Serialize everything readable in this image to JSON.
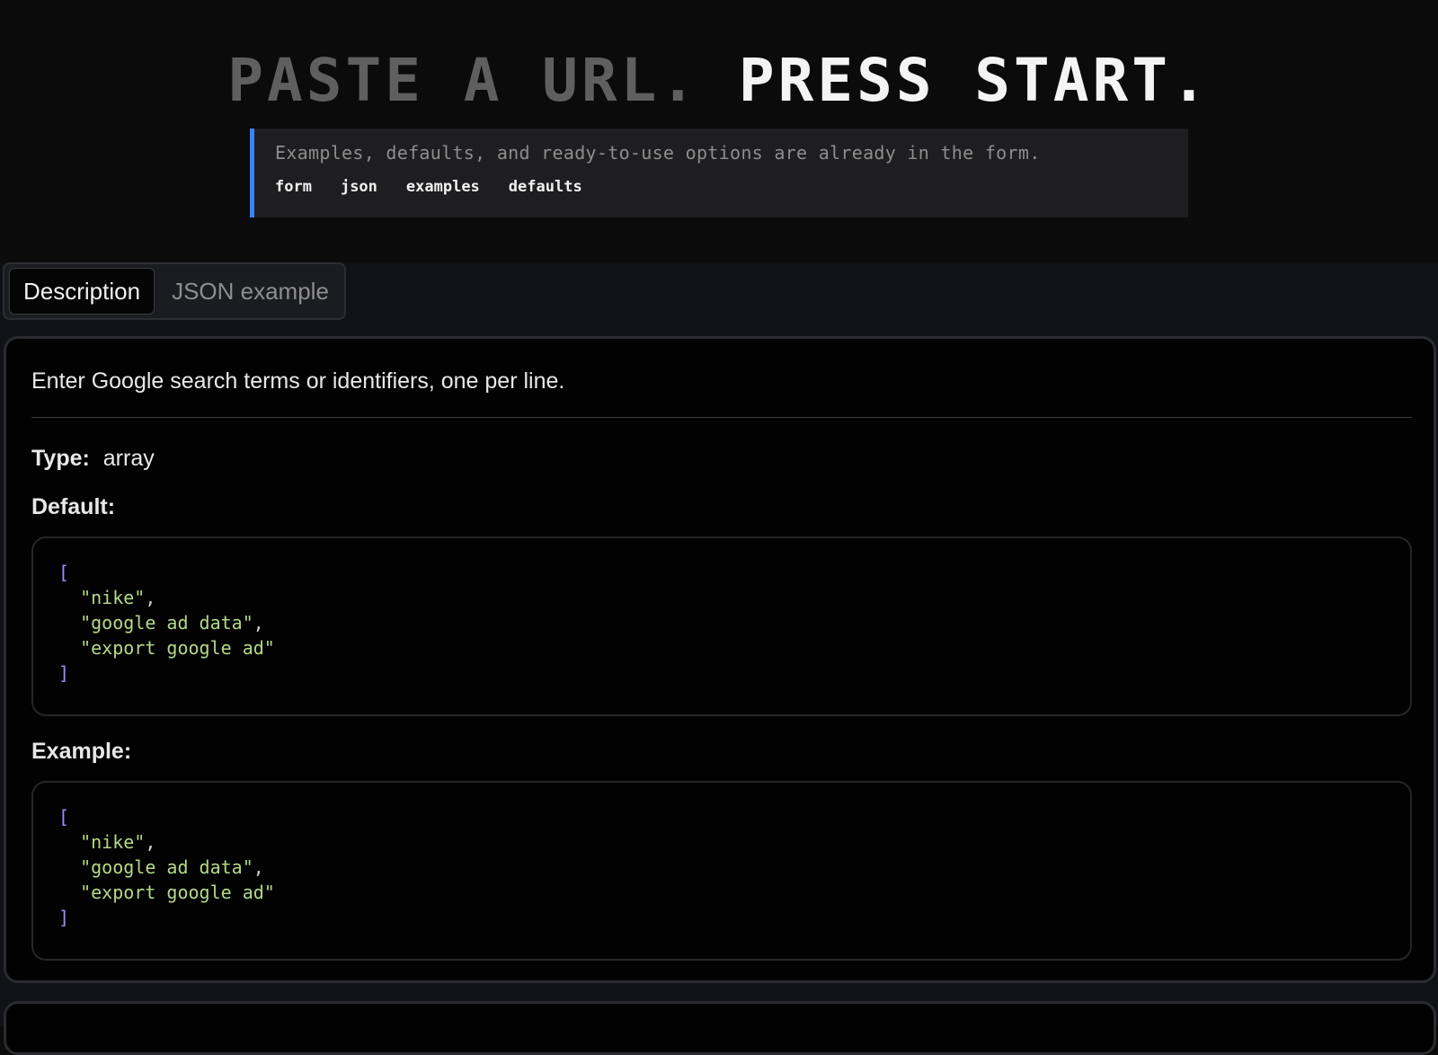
{
  "hero": {
    "title_part1": "PASTE A URL.",
    "title_part2": "PRESS START.",
    "callout_text": "Examples, defaults, and ready-to-use options are already in the form.",
    "links": [
      "form",
      "json",
      "examples",
      "defaults"
    ],
    "accent_color": "#3b82f6"
  },
  "tabs": {
    "description": "Description",
    "json_example": "JSON example",
    "active": "Description"
  },
  "field": {
    "description": "Enter Google search terms or identifiers, one per line.",
    "type_label": "Type:",
    "type_value": "array",
    "default_label": "Default:",
    "example_label": "Example:",
    "default_code": {
      "open": "[",
      "items": [
        "\"nike\"",
        "\"google ad data\"",
        "\"export google ad\""
      ],
      "close": "]"
    },
    "example_code": {
      "open": "[",
      "items": [
        "\"nike\"",
        "\"google ad data\"",
        "\"export google ad\""
      ],
      "close": "]"
    }
  }
}
